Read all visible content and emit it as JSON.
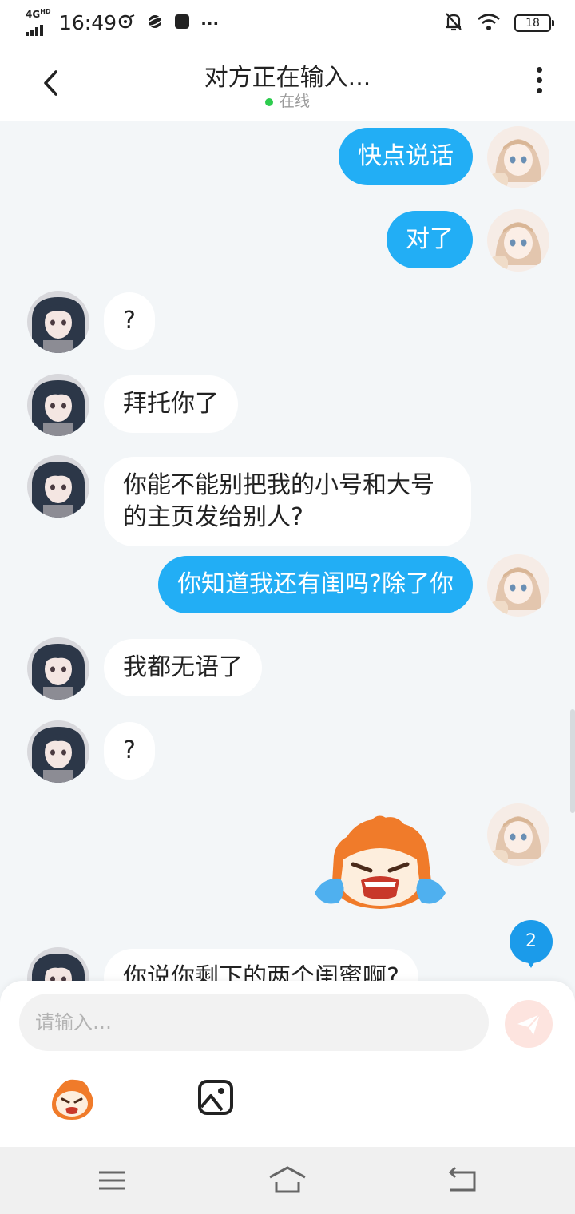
{
  "status_bar": {
    "network": "4G",
    "network_sup": "HD",
    "time": "16:49",
    "overflow": "···",
    "battery": "18",
    "icons": [
      "signal-icon",
      "vinyl-icon",
      "planet-icon",
      "app-icon",
      "mute-bell-icon",
      "wifi-icon",
      "battery-icon"
    ]
  },
  "header": {
    "title": "对方正在输入...",
    "status": "在线",
    "status_color": "#2dcc4e"
  },
  "messages": [
    {
      "side": "out",
      "text": "快点说话"
    },
    {
      "side": "out",
      "text": "对了"
    },
    {
      "side": "in",
      "text": "?"
    },
    {
      "side": "in",
      "text": "拜托你了"
    },
    {
      "side": "in",
      "text": "你能不能别把我的小号和大号的主页发给别人?"
    },
    {
      "side": "out",
      "text": "你知道我还有闺吗?除了你"
    },
    {
      "side": "in",
      "text": "我都无语了"
    },
    {
      "side": "in",
      "text": "?"
    },
    {
      "side": "out",
      "type": "sticker",
      "sticker": "crying-cartoon-sticker"
    },
    {
      "side": "in",
      "text": "你说你剩下的两个闺蜜啊?"
    }
  ],
  "unread_badge": "2",
  "composer": {
    "placeholder": "请输入…",
    "send_icon": "paper-plane-icon",
    "emoji_icon": "cartoon-face-icon",
    "image_icon": "image-icon"
  },
  "colors": {
    "outgoing_bubble": "#22aef5",
    "incoming_bubble": "#ffffff",
    "chat_background": "#f3f6f8",
    "badge": "#1b9bea",
    "send_button": "#fde4df"
  },
  "system_nav": [
    "menu-icon",
    "home-icon",
    "back-nav-icon"
  ]
}
